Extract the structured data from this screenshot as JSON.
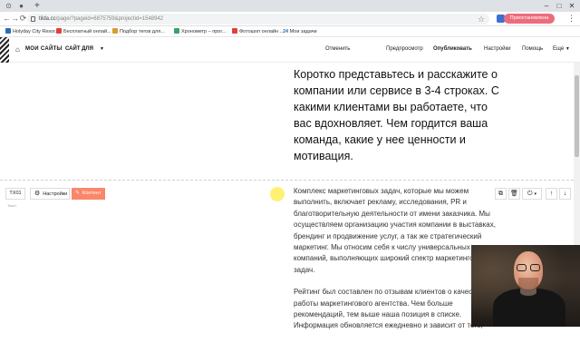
{
  "browser": {
    "url_host": "tilda.cc",
    "url_path": "/page/?pageid=6875759&projectid=1548942",
    "profile_label": "Приостановлена",
    "bookmarks": [
      {
        "label": "Holyday City Resor...",
        "color": "#2b6cb0"
      },
      {
        "label": "Бесплатный онлай...",
        "color": "#e53e3e"
      },
      {
        "label": "Подбор тегов для...",
        "color": "#d69e2e"
      },
      {
        "label": "Хронометр – прог...",
        "color": "#38a169"
      },
      {
        "label": "Фотошоп онлайн ...",
        "color": "#e53e3e"
      },
      {
        "label": "Мои задачи",
        "color": "#2b6cb0",
        "prefix": "24"
      }
    ]
  },
  "tilda_panel": {
    "my_sites": "МОИ САЙТЫ",
    "separator": "—",
    "site_name": "САЙТ ДЛЯ",
    "links": [
      "Отменить",
      "Предпросмотр",
      "Опубликовать",
      "Настройки",
      "Помощь",
      "Еще"
    ]
  },
  "page": {
    "intro_text": "Коротко представьтесь и расскажите о компании или сервисе в 3-4 строках. С какими клиентами вы работаете, что вас вдохновляет. Чем гордится ваша команда, какие у нее ценности и мотивация.",
    "block_id": "TX01",
    "settings_label": "Настройки",
    "content_label": "Контент",
    "block_code": "Текст",
    "paragraphs": [
      "Комплекс маркетинговых задач, которые мы можем выполнить, включает рекламу, исследования, PR и благотворительную деятельности от имени заказчика. Мы осуществляем организацию участия компании в выставках, брендинг и продвижение услуг, а так же стратегический маркетинг. Мы относим себя к числу универсальных компаний, выполняющих широкий спектр маркетинговых задач.",
      "Рейтинг был составлен по отзывам клиентов о качестве работы маркетингового агентства. Чем больше рекомендаций, тем выше наша позиция в списке. Информация обновляется ежедневно и зависит от того,"
    ]
  },
  "colors": {
    "accent_content": "#fa876b",
    "profile_pill": "#ec6c7c"
  }
}
